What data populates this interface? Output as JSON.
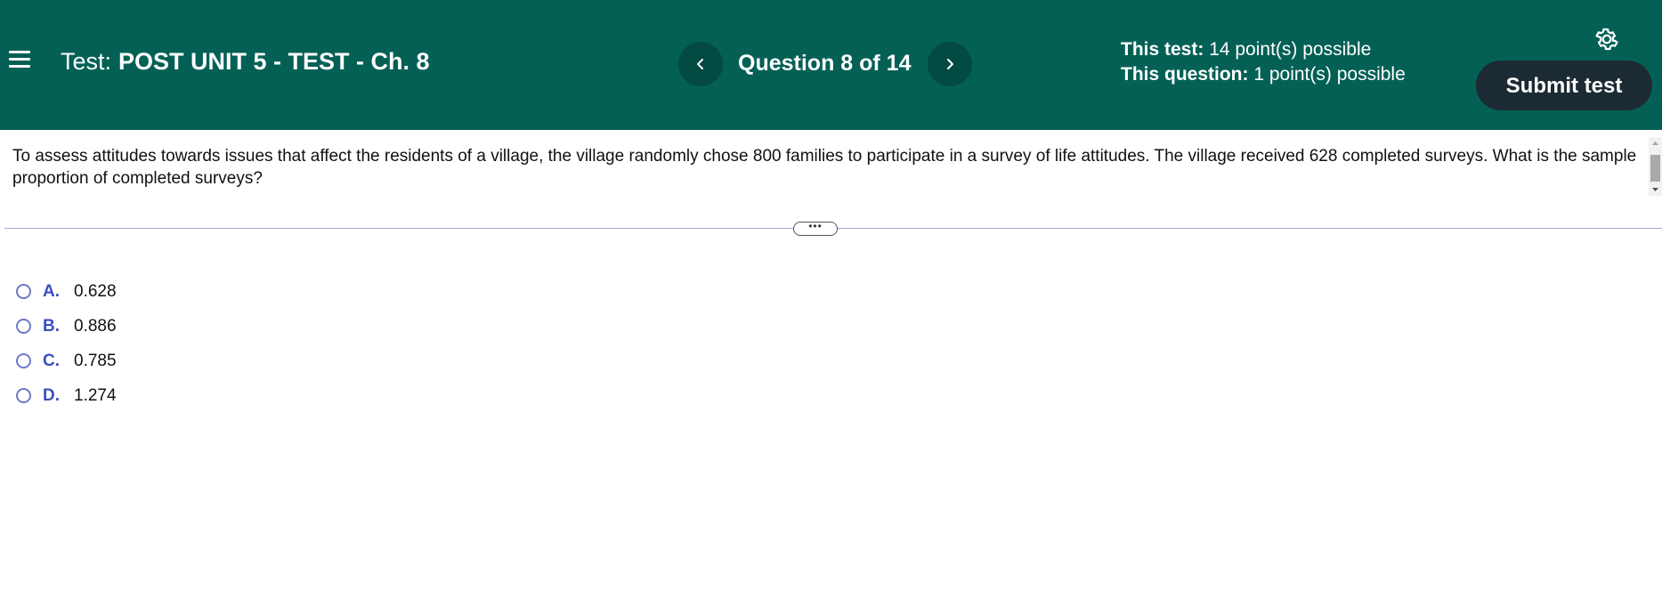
{
  "header": {
    "test_label": "Test:",
    "test_name": "POST UNIT 5 - TEST - Ch. 8",
    "question_counter": "Question 8 of 14",
    "test_points_label": "This test:",
    "test_points_value": "14 point(s) possible",
    "question_points_label": "This question:",
    "question_points_value": "1 point(s) possible",
    "submit_label": "Submit test",
    "icons": [
      "hamburger-menu-icon",
      "chevron-left-icon",
      "chevron-right-icon",
      "gear-icon"
    ]
  },
  "question": {
    "text": "To assess attitudes towards issues that affect the residents of a village, the village randomly chose 800 families to participate in a survey of life attitudes. The village received 628 completed surveys. What is the sample proportion of completed surveys?"
  },
  "divider": {
    "handle_label": "•••"
  },
  "choices": [
    {
      "letter": "A.",
      "value": "0.628"
    },
    {
      "letter": "B.",
      "value": "0.886"
    },
    {
      "letter": "C.",
      "value": "0.785"
    },
    {
      "letter": "D.",
      "value": "1.274"
    }
  ],
  "colors": {
    "header_bg": "#046055",
    "submit_bg": "#1c2a33",
    "choice_letter": "#3c4fbe",
    "radio_border": "#6e79c6"
  }
}
